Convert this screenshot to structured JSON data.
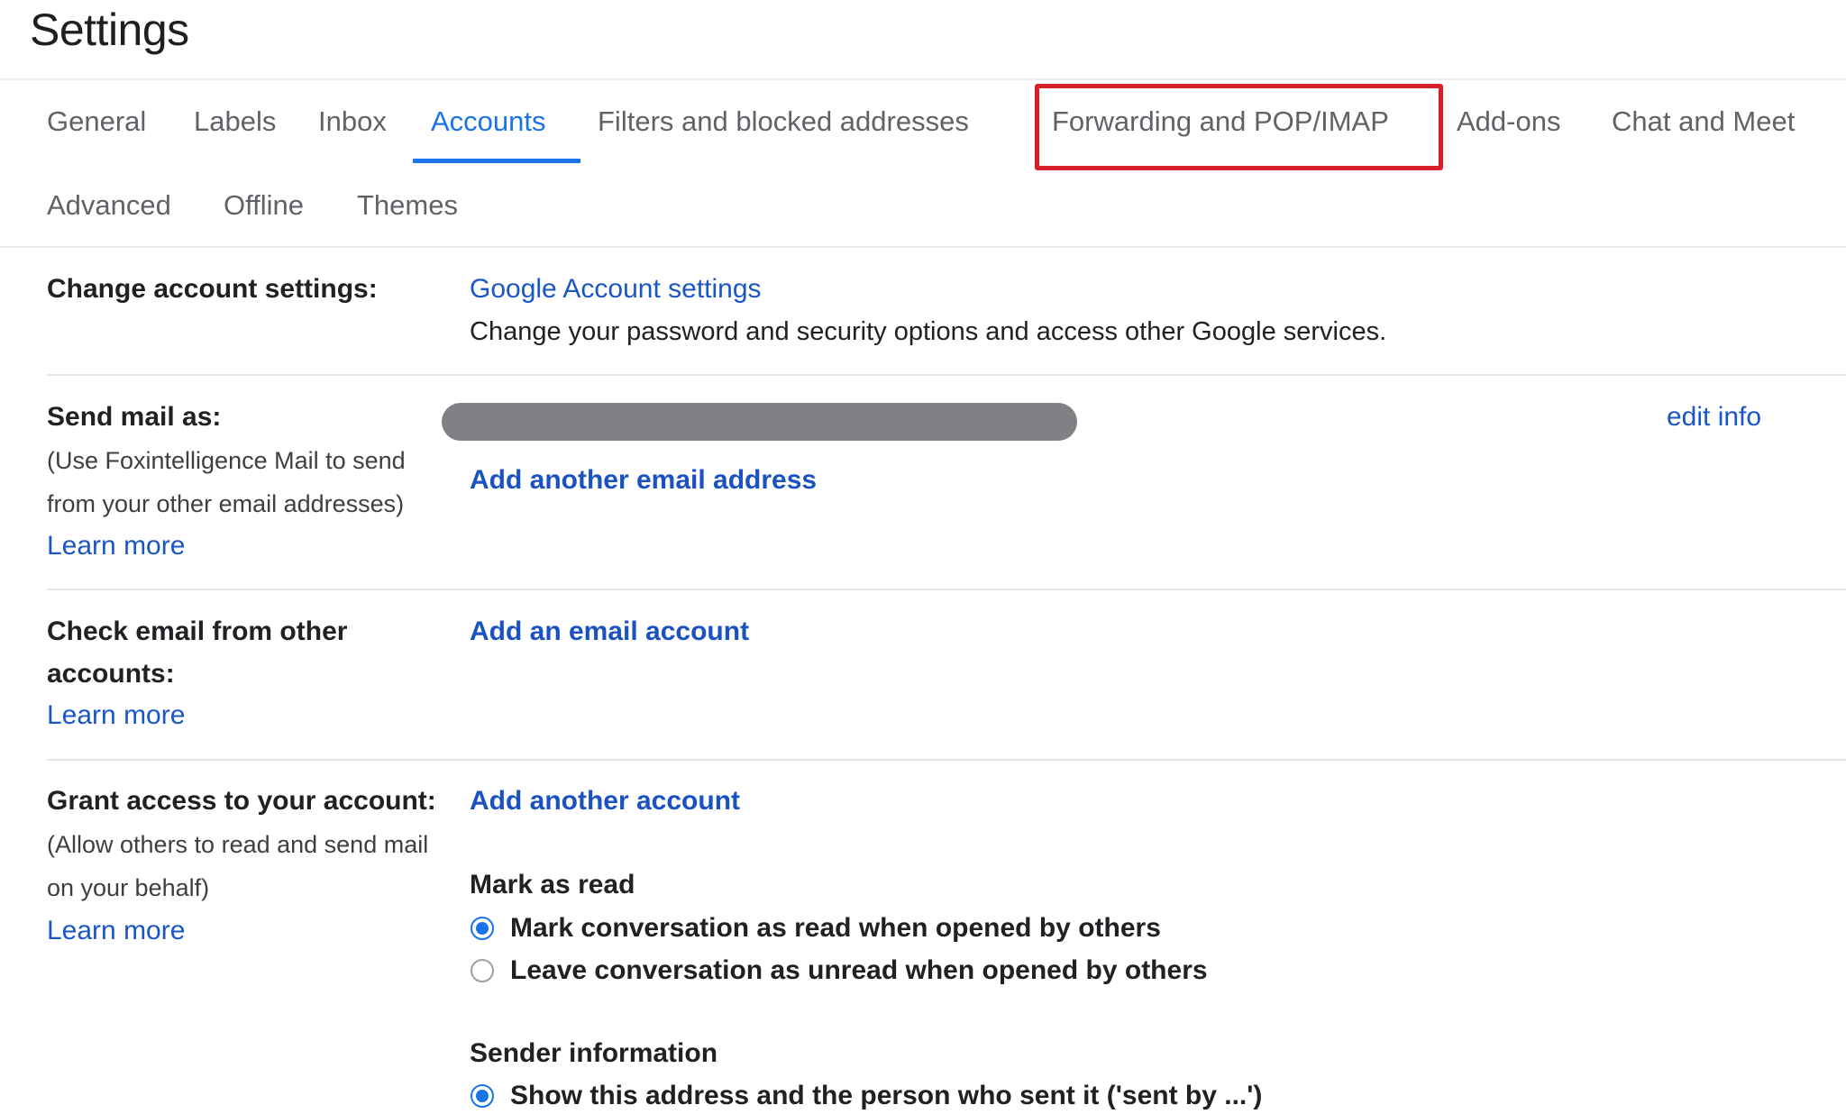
{
  "header": {
    "title": "Settings"
  },
  "tabs": {
    "row1": [
      {
        "label": "General",
        "active": false
      },
      {
        "label": "Labels",
        "active": false
      },
      {
        "label": "Inbox",
        "active": false
      },
      {
        "label": "Accounts",
        "active": true
      },
      {
        "label": "Filters and blocked addresses",
        "active": false
      },
      {
        "label": "Forwarding and POP/IMAP",
        "active": false,
        "highlighted": true
      },
      {
        "label": "Add-ons",
        "active": false
      },
      {
        "label": "Chat and Meet",
        "active": false
      }
    ],
    "row2": [
      {
        "label": "Advanced",
        "active": false
      },
      {
        "label": "Offline",
        "active": false
      },
      {
        "label": "Themes",
        "active": false
      }
    ]
  },
  "colors": {
    "accent": "#1a73e8",
    "link": "#1a56c4",
    "highlight_box": "#d9202a",
    "redacted": "#808185"
  },
  "sections": {
    "change_account": {
      "label": "Change account settings:",
      "link": "Google Account settings",
      "description": "Change your password and security options and access other Google services."
    },
    "send_mail_as": {
      "label": "Send mail as:",
      "desc_line1": "(Use Foxintelligence Mail to send",
      "desc_line2": "from your other email addresses)",
      "learn_more": "Learn more",
      "email_value": "[redacted]",
      "edit_info": "edit info",
      "add_link": "Add another email address"
    },
    "check_email": {
      "label_line1": "Check email from other",
      "label_line2": "accounts:",
      "learn_more": "Learn more",
      "add_link": "Add an email account"
    },
    "grant_access": {
      "label": "Grant access to your account:",
      "desc_line1": "(Allow others to read and send mail",
      "desc_line2": "on your behalf)",
      "learn_more": "Learn more",
      "add_link": "Add another account",
      "mark_as_read": {
        "heading": "Mark as read",
        "options": [
          {
            "label": "Mark conversation as read when opened by others",
            "selected": true
          },
          {
            "label": "Leave conversation as unread when opened by others",
            "selected": false
          }
        ]
      },
      "sender_information": {
        "heading": "Sender information",
        "options": [
          {
            "label": "Show this address and the person who sent it ('sent by ...')",
            "selected": true
          }
        ]
      }
    }
  }
}
